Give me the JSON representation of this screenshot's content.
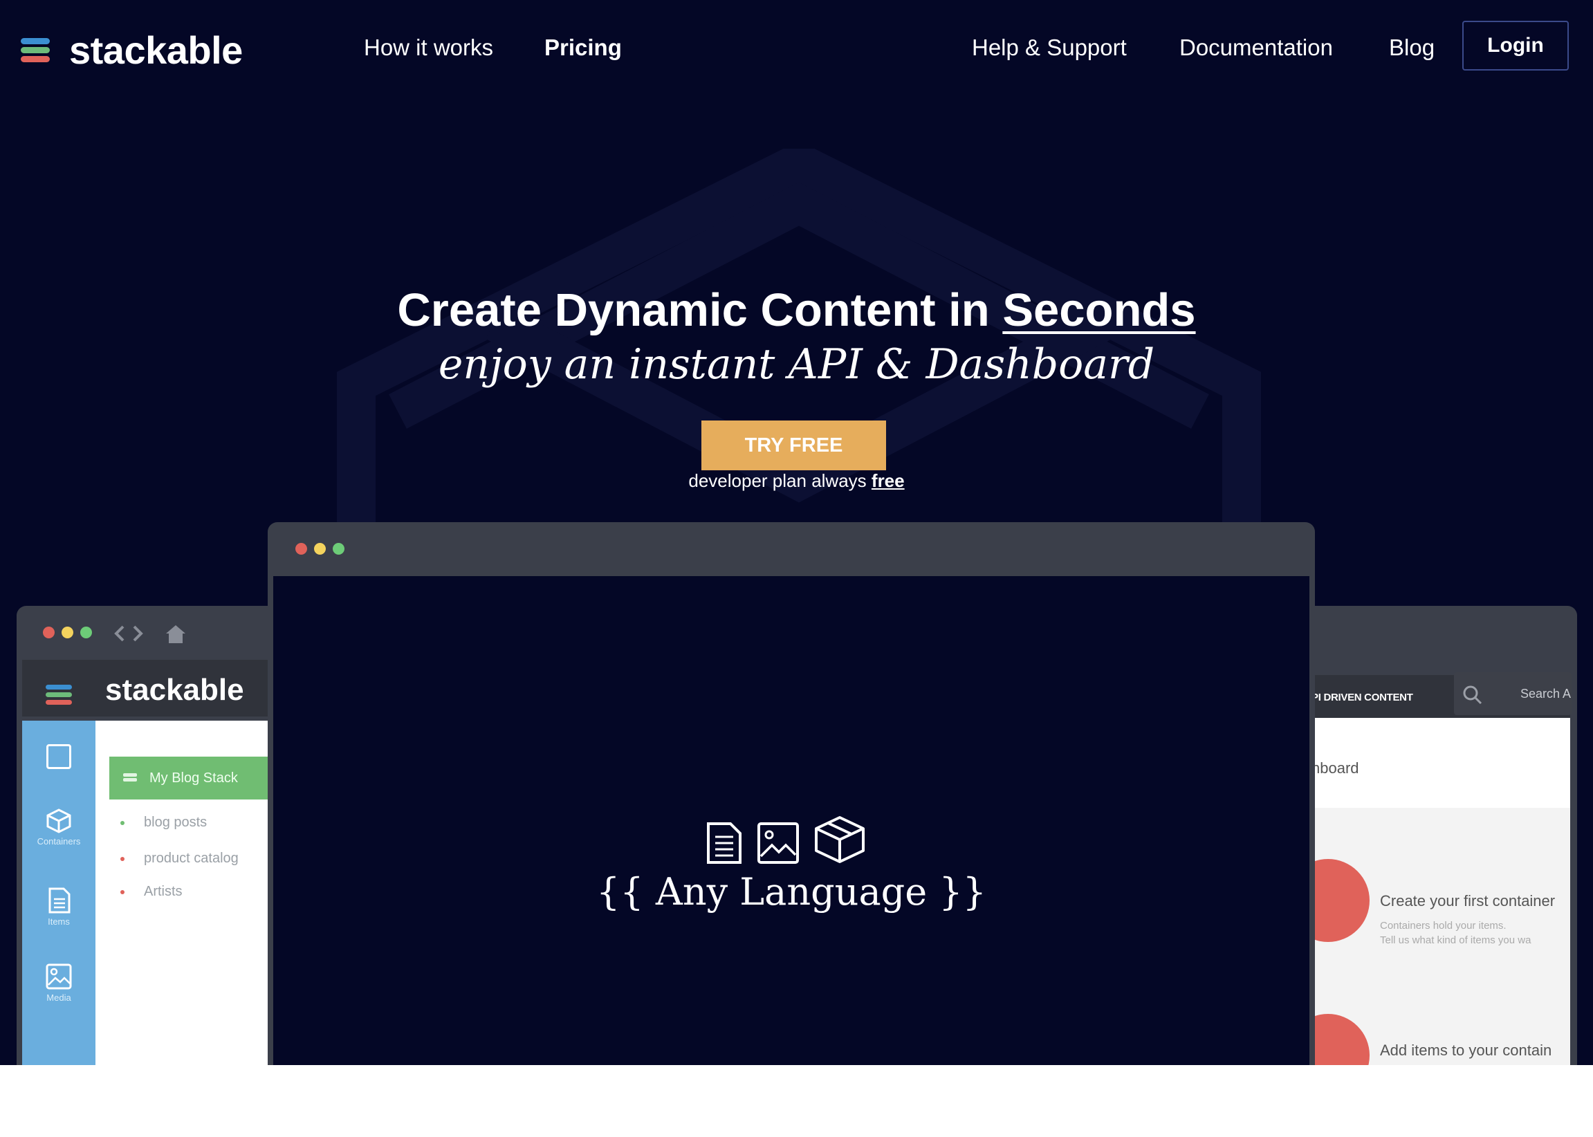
{
  "brand": {
    "name": "stackable",
    "logo_colors": [
      "#3b8fd1",
      "#6dbb7a",
      "#e0625a"
    ]
  },
  "nav": {
    "links": [
      "How it works",
      "Pricing",
      "Help & Support",
      "Documentation",
      "Blog"
    ],
    "login": "Login"
  },
  "hero": {
    "headline_prefix": "Create Dynamic Content in",
    "headline_emphasis": "Seconds",
    "subheadline": "enjoy an instant API & Dashboard",
    "cta_label": "TRY FREE",
    "cta_note_prefix": "developer plan always",
    "cta_note_link": "free"
  },
  "dashboard_preview": {
    "brand": "stackable",
    "sidebar": [
      "Containers",
      "Items",
      "Media"
    ],
    "stack_name": "My Blog Stack",
    "containers": [
      "blog posts",
      "product catalog",
      "Artists"
    ]
  },
  "center_preview": {
    "caption": "{{ Any Language }}",
    "icons": [
      "document-icon",
      "image-icon",
      "box-icon"
    ]
  },
  "api_preview": {
    "label": "PI DRIVEN CONTENT",
    "search_placeholder": "Search A",
    "heading": "hboard",
    "step1_title": "Create your first container",
    "step1_line1": "Containers hold your items.",
    "step1_line2": "Tell us what kind of items you wa",
    "step2_title": "Add items to your contain"
  },
  "colors": {
    "background": "#040726",
    "accent": "#e6ad5c",
    "sidebar": "#6aaede",
    "stack_chip": "#70bd72",
    "alert": "#e0625a"
  }
}
